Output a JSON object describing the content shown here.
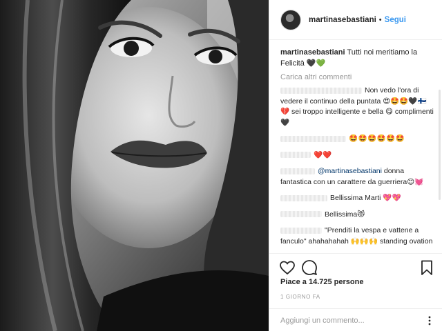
{
  "post": {
    "username": "martinasebastiani",
    "header_separator": "•",
    "follow_label": "Segui"
  },
  "caption": {
    "username": "martinasebastiani",
    "text": "Tutti noi meritiamo la Felicità 🖤💚"
  },
  "load_more_label": "Carica altri commenti",
  "comments": [
    {
      "text": "Non vedo l'ora di vedere il continuo della puntata 😍🤩🤩🖤🇫🇮💔 sei troppo intelligente e bella 😋 complimenti 🖤"
    },
    {
      "text": "🤩🤩🤩🤩🤩🤩"
    },
    {
      "text": "❤️❤️"
    },
    {
      "mention": "@martinasebastiani",
      "text": " donna fantastica con un carattere da guerriera😊💓"
    },
    {
      "text": "Bellissima Marti 💖💖"
    },
    {
      "text": "Bellissima😻"
    },
    {
      "text": "\"Prenditi la vespa e vattene a fanculo\" ahahahahah 🙌🙌🙌 standing ovation"
    }
  ],
  "likes_text": "Piace a 14.725 persone",
  "time_text": "1 GIORNO FA",
  "add_comment_placeholder": "Aggiungi un commento...",
  "icons": {
    "like": "heart-icon",
    "comment": "comment-icon",
    "save": "bookmark-icon",
    "more": "more-options-icon"
  }
}
